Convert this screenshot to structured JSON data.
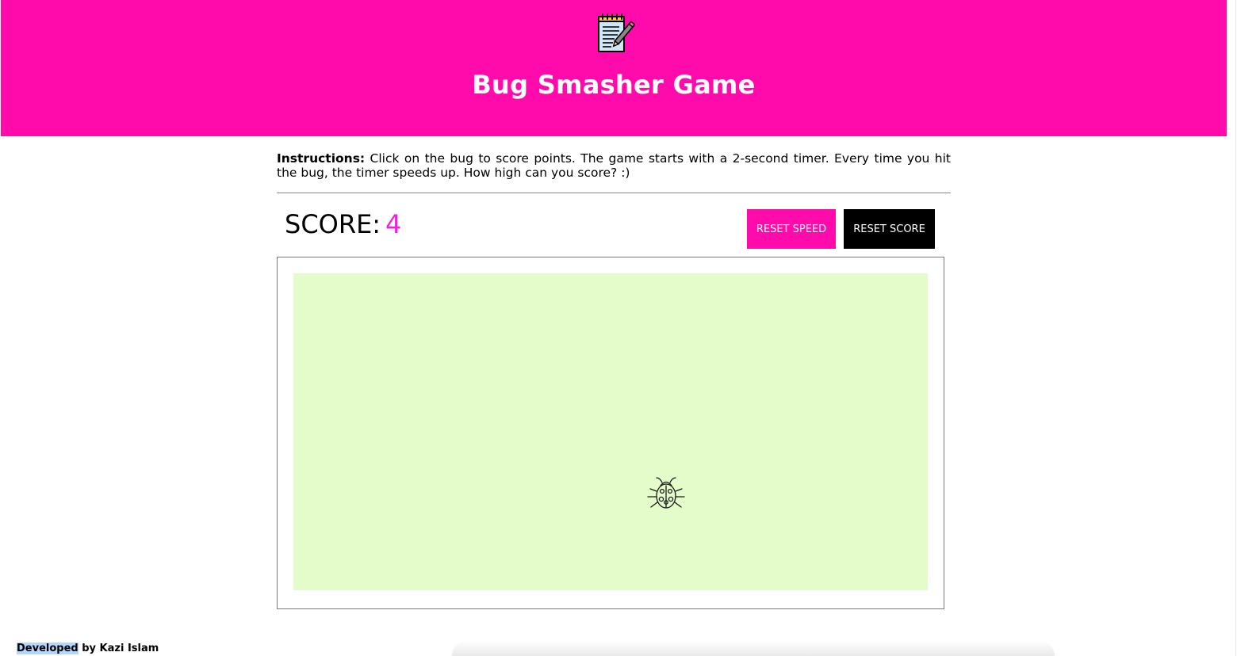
{
  "header": {
    "logo_icon": "notepad-pencil-icon",
    "title": "Bug Smasher Game",
    "background_color": "#ff0aab"
  },
  "instructions": {
    "label": "Instructions:",
    "text": " Click on the bug to score points. The game starts with a 2-second timer. Every time you hit the bug, the timer speeds up. How high can you score? :)"
  },
  "scoreboard": {
    "label": "SCORE:",
    "value": "4",
    "value_color": "#ee22dd"
  },
  "controls": {
    "reset_speed_label": "RESET SPEED",
    "reset_score_label": "RESET SCORE"
  },
  "game": {
    "board_color": "#e3fcca",
    "bug_icon": "ladybug-icon"
  },
  "footer": {
    "highlighted": "Developed",
    "rest": " by Kazi Islam"
  }
}
